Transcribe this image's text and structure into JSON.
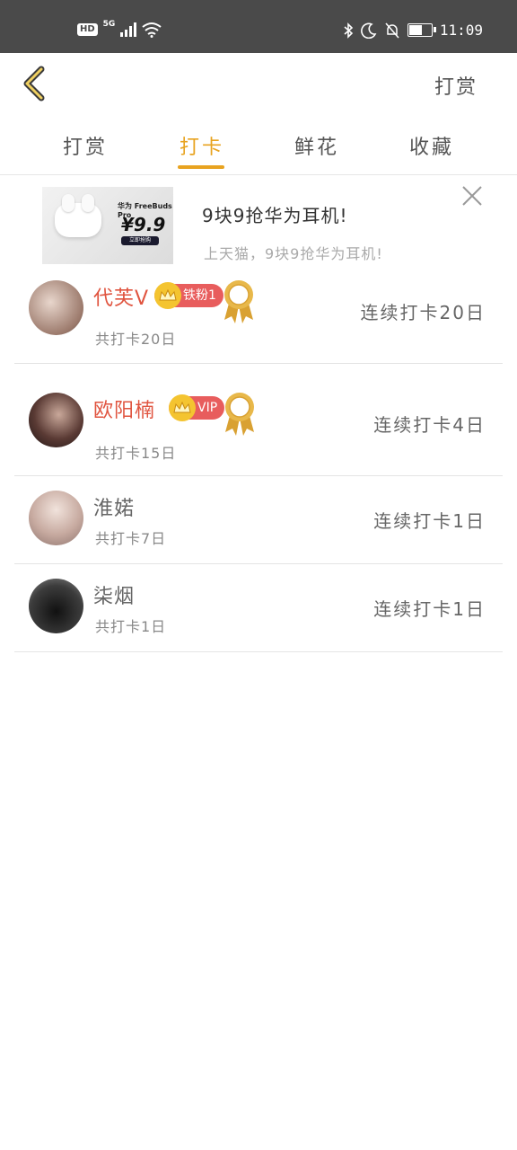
{
  "status_bar": {
    "hd": "HD",
    "network": "5G",
    "time": "11:09",
    "battery_icon": "battery-icon",
    "battery_level": 0.6
  },
  "header": {
    "back_icon": "chevron-left-icon",
    "action_label": "打赏"
  },
  "tabs": [
    {
      "label": "打赏",
      "active": false
    },
    {
      "label": "打卡",
      "active": true
    },
    {
      "label": "鲜花",
      "active": false
    },
    {
      "label": "收藏",
      "active": false
    }
  ],
  "ad": {
    "title": "9块9抢华为耳机!",
    "subtitle": "上天猫，9块9抢华为耳机!",
    "image_brand": "华为 FreeBuds Pro",
    "image_price": "¥9.9",
    "image_button": "立即抢购",
    "close_icon": "close-icon"
  },
  "users": [
    {
      "name": "代芙V",
      "name_color": "#e0543f",
      "badge": "铁粉1",
      "has_medal": true,
      "total": "共打卡20日",
      "streak": "连续打卡20日"
    },
    {
      "name": "欧阳楠",
      "name_color": "#e0543f",
      "badge": "VIP",
      "has_medal": true,
      "total": "共打卡15日",
      "streak": "连续打卡4日"
    },
    {
      "name": "淮婼",
      "name_color": "#666666",
      "badge": "",
      "has_medal": false,
      "total": "共打卡7日",
      "streak": "连续打卡1日"
    },
    {
      "name": "柒烟",
      "name_color": "#666666",
      "badge": "",
      "has_medal": false,
      "total": "共打卡1日",
      "streak": "连续打卡1日"
    }
  ],
  "colors": {
    "accent": "#e8a320",
    "vip_red": "#e85d5d",
    "status_bar": "#4a4a4a"
  }
}
